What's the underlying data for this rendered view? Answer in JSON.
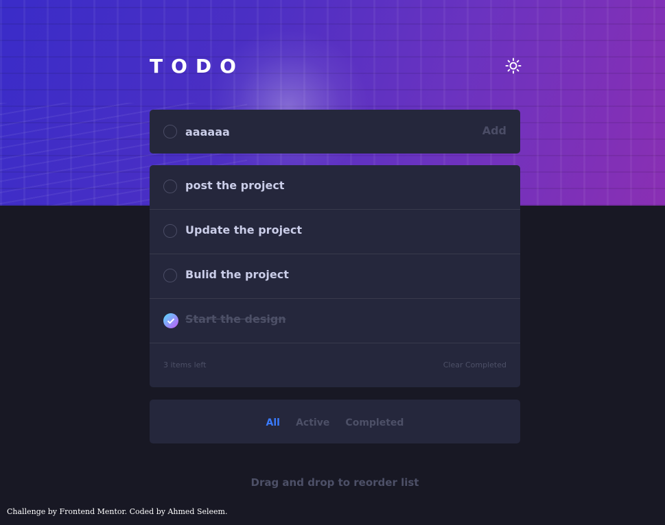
{
  "header": {
    "title": "TODO",
    "theme_toggle_icon": "sun-icon"
  },
  "new_todo": {
    "value": "aaaaaa",
    "add_label": "Add"
  },
  "todos": [
    {
      "text": "post the project",
      "completed": false
    },
    {
      "text": "Update the project",
      "completed": false
    },
    {
      "text": "Bulid the project",
      "completed": false
    },
    {
      "text": "Start the design",
      "completed": true
    }
  ],
  "list_footer": {
    "items_left": "3 items left",
    "clear_label": "Clear Completed"
  },
  "filters": {
    "all": "All",
    "active": "Active",
    "completed": "Completed",
    "selected": "All"
  },
  "hint": "Drag and drop to reorder list",
  "credit": "Challenge by Frontend Mentor. Coded by Ahmed Seleem.",
  "colors": {
    "background": "#181824",
    "card": "#25273c",
    "accent": "#3a7bfd",
    "check_gradient_start": "#57ddff",
    "check_gradient_end": "#c058f3"
  }
}
